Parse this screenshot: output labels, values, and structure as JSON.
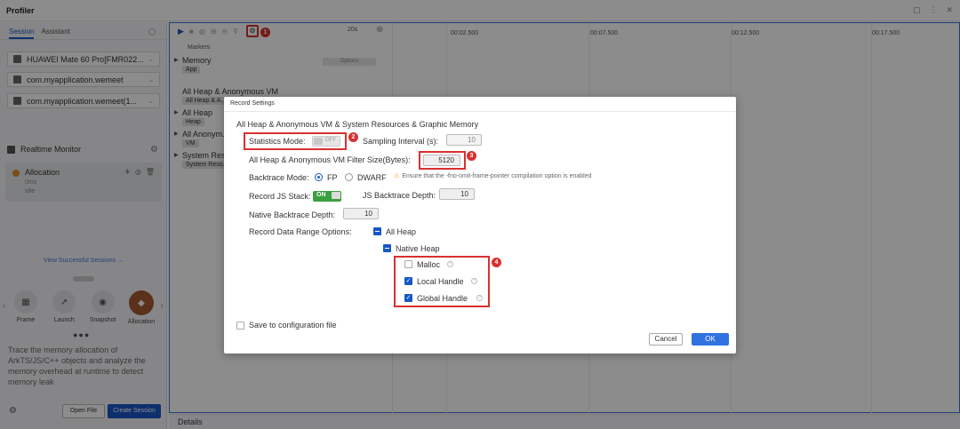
{
  "app": {
    "title": "Profiler"
  },
  "sidebar": {
    "tabs": [
      "Session",
      "Assistant"
    ],
    "device": "HUAWEI Mate 60 Pro[FMR022...",
    "app_package": "com.myapplication.wemeet",
    "process": "com.myapplication.wemeet(1...",
    "realtime_monitor": "Realtime Monitor",
    "allocation": {
      "name": "Allocation",
      "time": "0ms",
      "state": "Idle"
    },
    "view_sessions": "View Successful Sessions →",
    "modes": [
      "Frame",
      "Launch",
      "Snapshot",
      "Allocation"
    ],
    "description": "Trace the memory allocation of ArkTS/JS/C++ objects and analyze the memory overhead at runtime to detect memory leak",
    "open_file": "Open File",
    "create_session": "Create Session"
  },
  "toolbar": {
    "duration": "20s",
    "badge_1": "1"
  },
  "timeline": {
    "ticks": [
      "00:02.500",
      "00:07.500",
      "00:12.500",
      "00:17.500"
    ]
  },
  "tracks": {
    "markers": "Markers",
    "memory": "Memory",
    "memory_tag": "App",
    "option_pill": "Options",
    "all_heap_anon": "All Heap & Anonymous VM",
    "all_heap_anon_tag": "All Heap & A...",
    "all_heap": "All Heap",
    "all_heap_tag": "Heap",
    "all_anon": "All Anonym...",
    "all_anon_tag": "VM",
    "system_res": "System Res...",
    "system_res_tag": "System Reso..."
  },
  "details": "Details",
  "dialog": {
    "title": "Record Settings",
    "heading": "All Heap & Anonymous VM & System Resources & Graphic Memory",
    "statistics_mode_label": "Statistics Mode:",
    "statistics_mode_value": "OFF",
    "sampling_interval_label": "Sampling Interval (s):",
    "sampling_interval_value": "10",
    "filter_size_label": "All Heap & Anonymous VM Filter Size(Bytes):",
    "filter_size_value": "5120",
    "backtrace_mode_label": "Backtrace Mode:",
    "backtrace_fp": "FP",
    "backtrace_dwarf": "DWARF",
    "warning": "Ensure that the -fno-omit-frame-pointer compilation option is enabled",
    "record_js_stack_label": "Record JS Stack:",
    "record_js_stack_value": "ON",
    "js_backtrace_depth_label": "JS Backtrace Depth:",
    "js_backtrace_depth_value": "10",
    "native_backtrace_depth_label": "Native Backtrace Depth:",
    "native_backtrace_depth_value": "10",
    "data_range_label": "Record Data Range Options:",
    "all_heap": "All Heap",
    "native_heap": "Native Heap",
    "malloc": "Malloc",
    "local_handle": "Local Handle",
    "global_handle": "Global Handle",
    "save_config": "Save to configuration file",
    "cancel": "Cancel",
    "ok": "OK",
    "badges": [
      "2",
      "3",
      "4"
    ]
  },
  "colors": {
    "accent": "#1a57c6",
    "highlight": "#d93030",
    "toggle_on": "#3aa040"
  }
}
